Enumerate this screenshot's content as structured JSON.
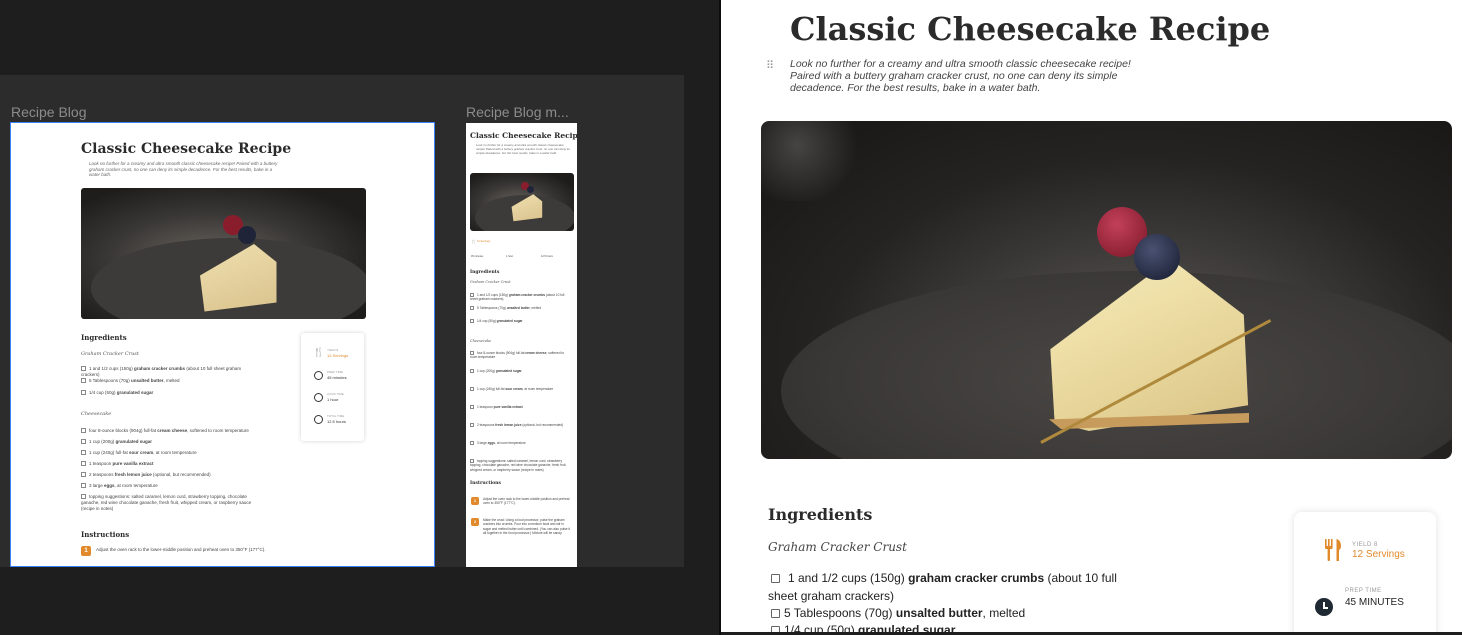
{
  "canvas": {
    "frame_desktop_label": "Recipe Blog",
    "frame_mobile_label": "Recipe Blog m..."
  },
  "recipe": {
    "title": "Classic Cheesecake Recipe",
    "description": "Look no further for a creamy and ultra smooth classic cheesecake recipe! Paired with a buttery graham cracker crust, no one can deny its simple decadence. For the best results, bake in a water bath.",
    "ingredients_heading": "Ingredients",
    "crust_heading": "Graham Cracker Crust",
    "crust_items": [
      {
        "prefix": "1 and 1/2 cups (150g) ",
        "bold": "graham cracker crumbs",
        "suffix": " (about 10 full sheet graham crackers)"
      },
      {
        "prefix": "5 Tablespoons (70g) ",
        "bold": "unsalted butter",
        "suffix": ", melted"
      },
      {
        "prefix": "1/4 cup (50g) ",
        "bold": "granulated sugar",
        "suffix": ""
      }
    ],
    "cheesecake_heading": "Cheesecake",
    "cheesecake_items": [
      {
        "prefix": "four 8-ounce blocks (904g) full-fat ",
        "bold": "cream cheese",
        "suffix": ", softened to room temperature"
      },
      {
        "prefix": "1 cup (200g) ",
        "bold": "granulated sugar",
        "suffix": ""
      },
      {
        "prefix": "1 cup (240g) full-fat ",
        "bold": "sour cream",
        "suffix": ", at room temperature"
      },
      {
        "prefix": "1 teaspoon ",
        "bold": "pure vanilla extract",
        "suffix": ""
      },
      {
        "prefix": "2 teaspoons ",
        "bold": "fresh lemon juice",
        "suffix": " (optional, but recommended)"
      },
      {
        "prefix": "3 large ",
        "bold": "eggs",
        "suffix": ", at room temperature"
      },
      {
        "prefix": "topping suggestions: ",
        "bold": "",
        "suffix": "salted caramel, lemon curd, strawberry topping, chocolate ganache, red wine chocolate ganache, fresh fruit, whipped cream, or raspberry sauce (recipe in notes)"
      }
    ],
    "instructions_heading": "Instructions",
    "steps": [
      {
        "num": "1",
        "text": "Adjust the oven rack to the lower-middle position and preheat oven to 350°F (177°C)."
      },
      {
        "num": "2",
        "text": "Make the crust: Using a food processor, pulse the graham crackers into crumbs. Pour into a medium bowl and stir in sugar and melted butter until combined. (You can also pulse it all together in the food processor.) Mixture will be sandy."
      }
    ],
    "info": {
      "yield_label": "YIELD 8",
      "yield_value": "12 Servings",
      "prep_label": "PREP TIME",
      "prep_value": "45 MINUTES",
      "prep_value_mini": "45 minutes",
      "cook_label": "COOK TIME",
      "cook_value": "1 hour",
      "total_label": "TOTAL TIME",
      "total_value": "12.5 hours"
    }
  },
  "colors": {
    "accent": "#e08a2c",
    "selection": "#3b82f6",
    "canvas_bg": "#1e1e1e",
    "canvas_area": "#2c2c2c"
  },
  "icons": [
    "fork-knife-icon",
    "clock-icon",
    "drag-handle-icon"
  ]
}
